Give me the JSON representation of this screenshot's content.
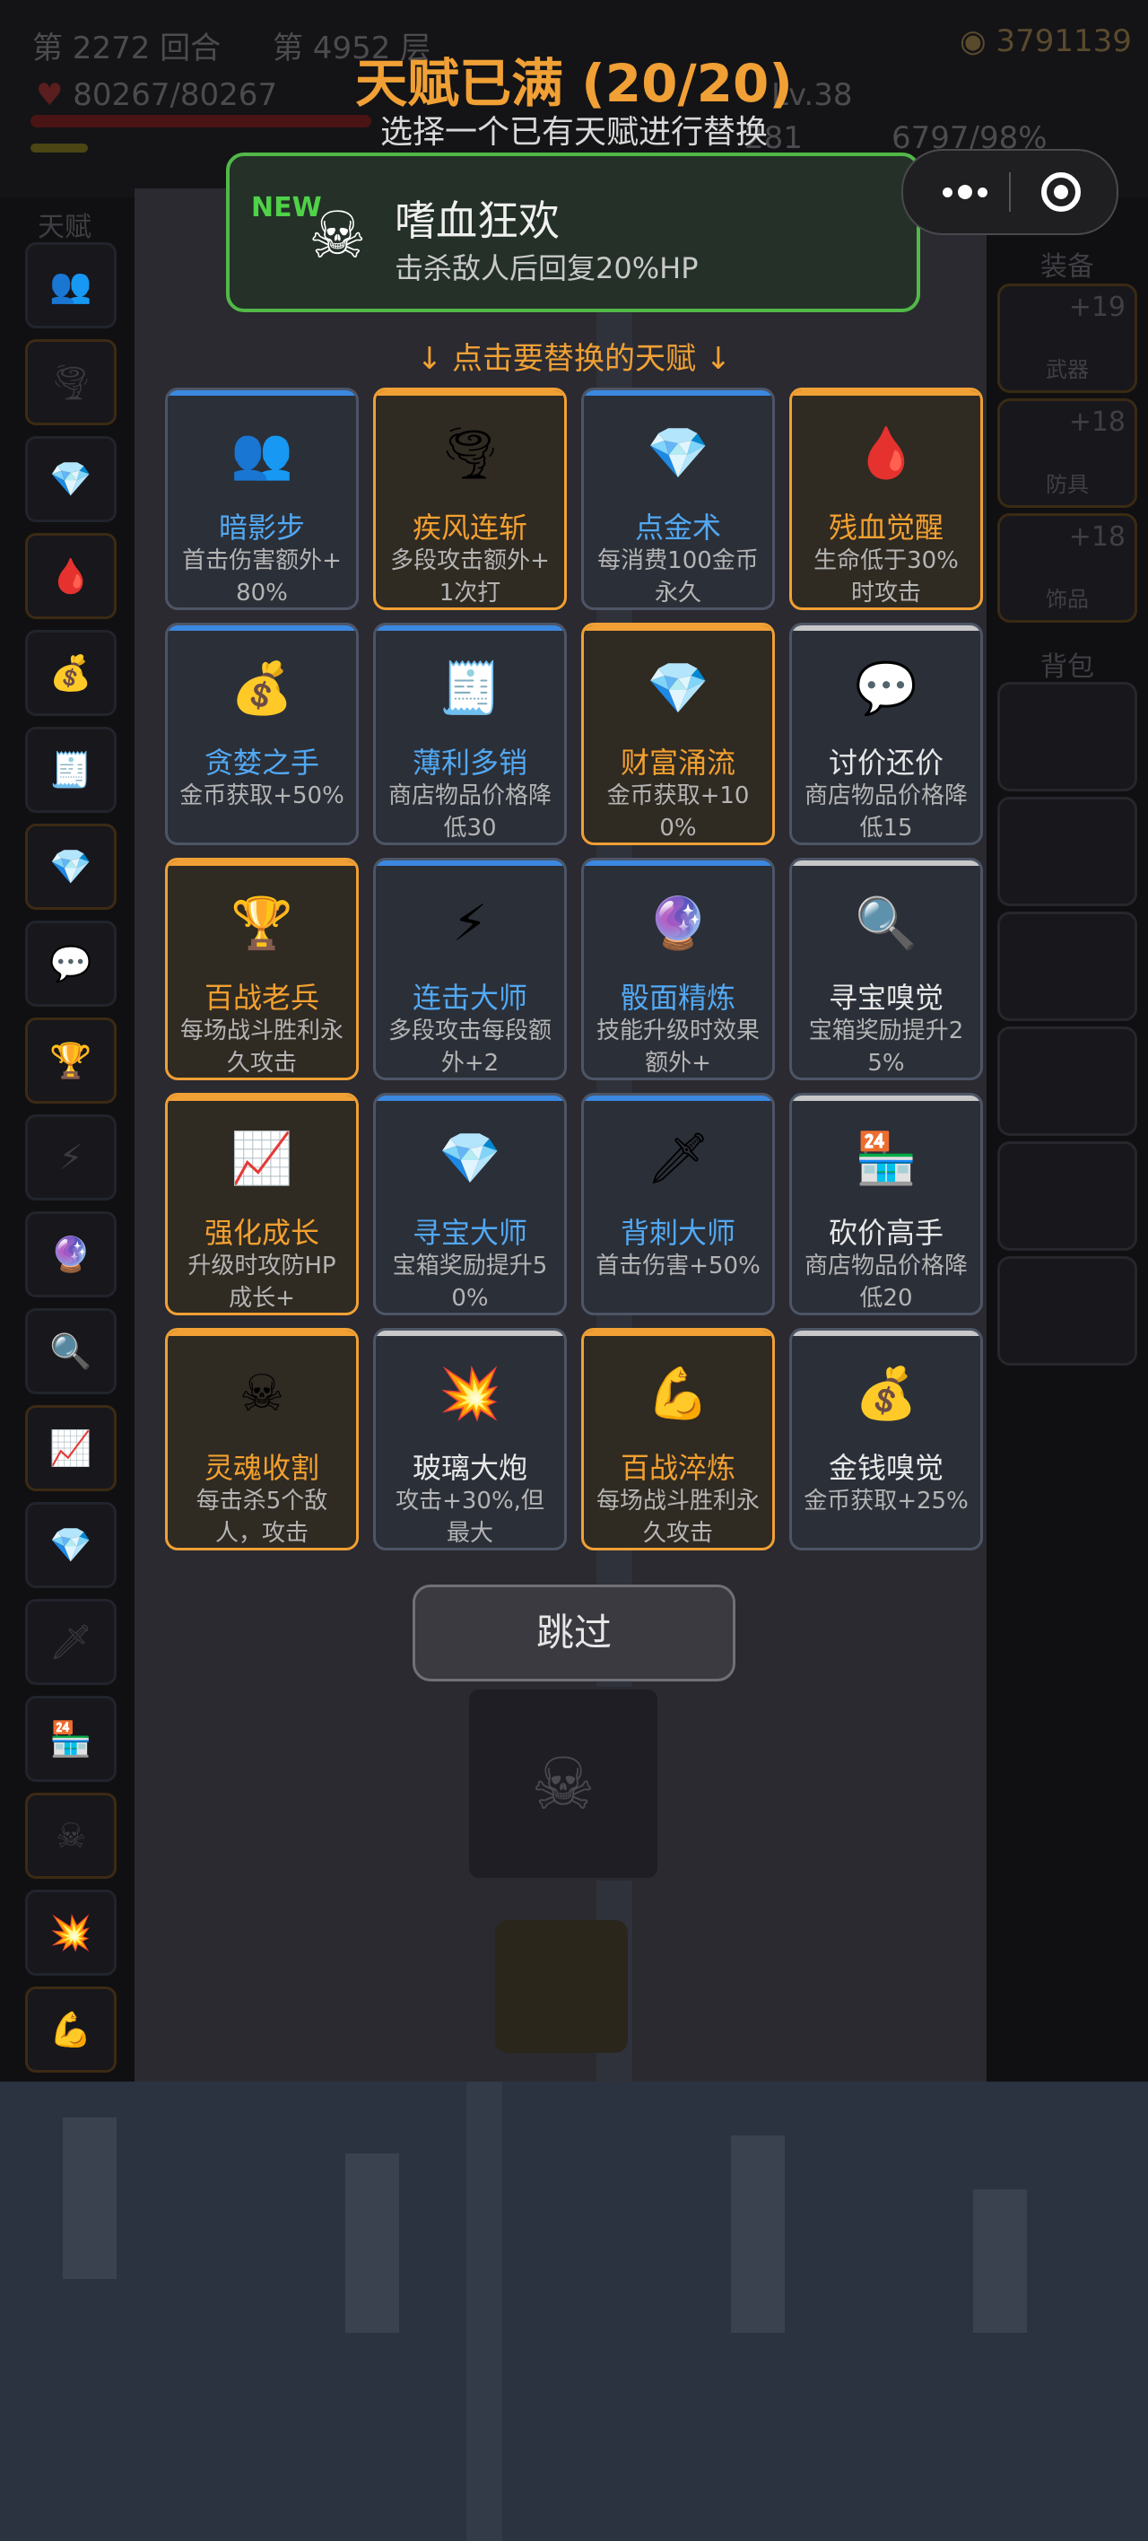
{
  "background": {
    "stats": {
      "round": "第 2272 回合",
      "floor": "第 4952 层",
      "gold": "3791139",
      "hp": "80267/80267",
      "level": "Lv.38",
      "exp": "6797/98%",
      "exp_left": "281"
    },
    "left_label": "天赋",
    "right_labels": {
      "equipment": "装备",
      "backpack": "背包"
    },
    "equipment": [
      {
        "plus": "+19",
        "name": "武器"
      },
      {
        "plus": "+18",
        "name": "防具"
      },
      {
        "plus": "+18",
        "name": "饰品"
      }
    ]
  },
  "dialog": {
    "title": "天赋已满 (20/20)",
    "subtitle": "选择一个已有天赋进行替换",
    "new_talent": {
      "tag": "NEW",
      "icon": "skull-crossbones-icon",
      "name": "嗜血狂欢",
      "desc": "击杀敌人后回复20%HP"
    },
    "hint": "↓ 点击要替换的天赋 ↓",
    "skip_label": "跳过",
    "talents": [
      {
        "name": "暗影步",
        "desc": "首击伤害额外+80%",
        "rarity": "blue",
        "icon": "shadow-figures-icon",
        "glyph": "👥"
      },
      {
        "name": "疾风连斩",
        "desc": "多段攻击额外+1次打",
        "rarity": "orange",
        "icon": "tornado-icon",
        "glyph": "🌪"
      },
      {
        "name": "点金术",
        "desc": "每消费100金币永久",
        "rarity": "blue",
        "icon": "diamond-icon",
        "glyph": "💎"
      },
      {
        "name": "残血觉醒",
        "desc": "生命低于30%时攻击",
        "rarity": "orange",
        "icon": "blood-drop-icon",
        "glyph": "🩸"
      },
      {
        "name": "贪婪之手",
        "desc": "金币获取+50%",
        "rarity": "blue",
        "icon": "money-bag-icon",
        "glyph": "💰"
      },
      {
        "name": "薄利多销",
        "desc": "商店物品价格降低30",
        "rarity": "blue",
        "icon": "receipt-icon",
        "glyph": "🧾"
      },
      {
        "name": "财富涌流",
        "desc": "金币获取+100%",
        "rarity": "orange",
        "icon": "diamond-icon",
        "glyph": "💎"
      },
      {
        "name": "讨价还价",
        "desc": "商店物品价格降低15",
        "rarity": "white",
        "icon": "speech-bubble-icon",
        "glyph": "💬"
      },
      {
        "name": "百战老兵",
        "desc": "每场战斗胜利永久攻击",
        "rarity": "orange",
        "icon": "golden-helmet-icon",
        "glyph": "🏆"
      },
      {
        "name": "连击大师",
        "desc": "多段攻击每段额外+2",
        "rarity": "blue",
        "icon": "lightning-icon",
        "glyph": "⚡"
      },
      {
        "name": "骰面精炼",
        "desc": "技能升级时效果额外+",
        "rarity": "blue",
        "icon": "crystal-ball-icon",
        "glyph": "🔮"
      },
      {
        "name": "寻宝嗅觉",
        "desc": "宝箱奖励提升25%",
        "rarity": "white",
        "icon": "magnifier-icon",
        "glyph": "🔍"
      },
      {
        "name": "强化成长",
        "desc": "升级时攻防HP成长+",
        "rarity": "orange",
        "icon": "chart-growth-icon",
        "glyph": "📈"
      },
      {
        "name": "寻宝大师",
        "desc": "宝箱奖励提升50%",
        "rarity": "blue",
        "icon": "diamond-icon",
        "glyph": "💎"
      },
      {
        "name": "背刺大师",
        "desc": "首击伤害+50%",
        "rarity": "blue",
        "icon": "dagger-icon",
        "glyph": "🗡"
      },
      {
        "name": "砍价高手",
        "desc": "商店物品价格降低20",
        "rarity": "white",
        "icon": "shop-items-icon",
        "glyph": "🏪"
      },
      {
        "name": "灵魂收割",
        "desc": "每击杀5个敌人，攻击",
        "rarity": "orange",
        "icon": "skull-crossbones-icon",
        "glyph": "☠"
      },
      {
        "name": "玻璃大炮",
        "desc": "攻击+30%,但最大",
        "rarity": "white",
        "icon": "explosion-icon",
        "glyph": "💥"
      },
      {
        "name": "百战淬炼",
        "desc": "每场战斗胜利永久攻击",
        "rarity": "orange",
        "icon": "flexing-arm-icon",
        "glyph": "💪"
      },
      {
        "name": "金钱嗅觉",
        "desc": "金币获取+25%",
        "rarity": "white",
        "icon": "money-bag-icon",
        "glyph": "💰"
      }
    ]
  }
}
